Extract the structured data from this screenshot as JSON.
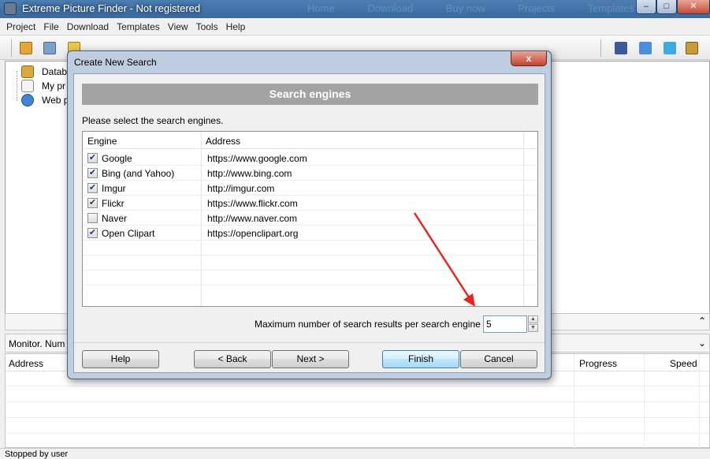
{
  "window": {
    "title": "Extreme Picture Finder - Not registered",
    "ghost_tabs": [
      "Home",
      "Download",
      "Buy now",
      "Projects",
      "Templates"
    ]
  },
  "menu": [
    "Project",
    "File",
    "Download",
    "Templates",
    "View",
    "Tools",
    "Help"
  ],
  "tree": {
    "items": [
      {
        "label": "Datab",
        "icon": "database-icon"
      },
      {
        "label": "My pr",
        "icon": "document-icon"
      },
      {
        "label": "Web p",
        "icon": "web-search-icon"
      }
    ]
  },
  "monitor": {
    "label": "Monitor. Num",
    "columns": {
      "address": "Address",
      "progress": "Progress",
      "speed": "Speed"
    }
  },
  "status": {
    "text": "Stopped by user"
  },
  "dialog": {
    "title": "Create New Search",
    "close_glyph": "x",
    "banner": "Search engines",
    "instruction": "Please select the search engines.",
    "columns": {
      "engine": "Engine",
      "address": "Address"
    },
    "engines": [
      {
        "name": "Google",
        "address": "https://www.google.com",
        "checked": true
      },
      {
        "name": "Bing (and Yahoo)",
        "address": "http://www.bing.com",
        "checked": true
      },
      {
        "name": "Imgur",
        "address": "http://imgur.com",
        "checked": true
      },
      {
        "name": "Flickr",
        "address": "https://www.flickr.com",
        "checked": true
      },
      {
        "name": "Naver",
        "address": "http://www.naver.com",
        "checked": false
      },
      {
        "name": "Open Clipart",
        "address": "https://openclipart.org",
        "checked": true
      }
    ],
    "max_results_label": "Maximum number of search results per search engine",
    "max_results_value": "5",
    "buttons": {
      "help": "Help",
      "back": "< Back",
      "next": "Next >",
      "finish": "Finish",
      "cancel": "Cancel"
    }
  },
  "colors": {
    "annotation_arrow": "#e8251c",
    "banner": "#a3a3a3",
    "titlebar": "#3f6fa5"
  }
}
